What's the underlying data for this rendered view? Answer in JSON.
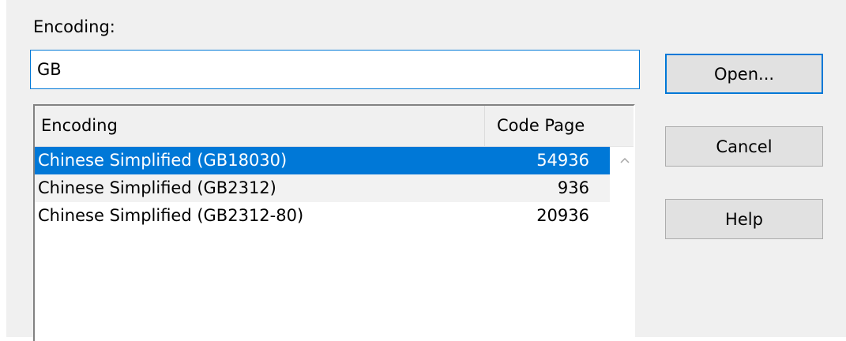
{
  "dialog": {
    "encoding_label": "Encoding:",
    "search": {
      "value": "GB"
    },
    "list": {
      "columns": {
        "encoding": "Encoding",
        "code_page": "Code Page"
      },
      "rows": [
        {
          "name": "Chinese Simplified (GB18030)",
          "code_page": "54936",
          "selected": true
        },
        {
          "name": "Chinese Simplified (GB2312)",
          "code_page": "936",
          "selected": false
        },
        {
          "name": "Chinese Simplified (GB2312-80)",
          "code_page": "20936",
          "selected": false
        }
      ]
    },
    "buttons": {
      "open": "Open...",
      "cancel": "Cancel",
      "help": "Help"
    }
  },
  "colors": {
    "selection": "#0078d7",
    "dialog_bg": "#f0f0f0",
    "button_bg": "#e1e1e1"
  },
  "icons": {
    "scroll_up": "chevron-up-icon"
  }
}
